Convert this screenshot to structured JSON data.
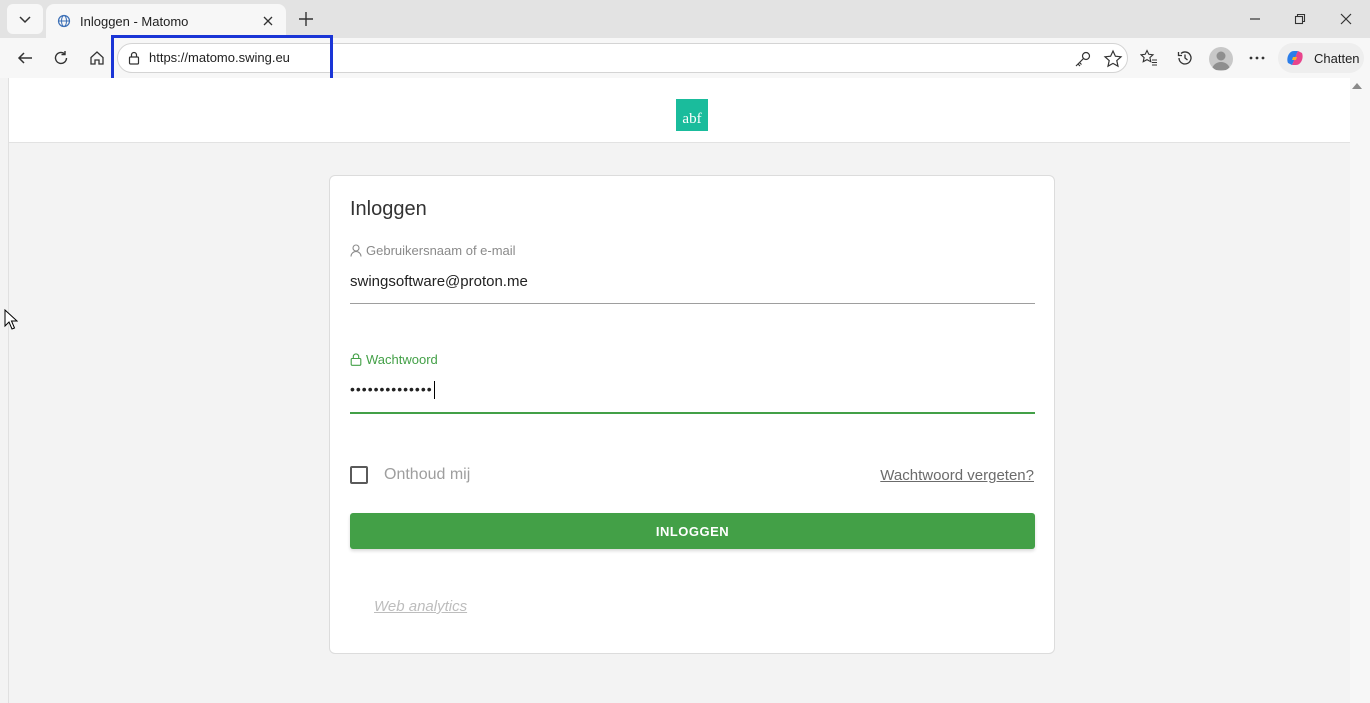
{
  "browser": {
    "tab": {
      "title": "Inloggen - Matomo"
    },
    "address": {
      "url": "https://matomo.swing.eu"
    },
    "copilot_label": "Chatten",
    "highlight_color": "#1a35d6"
  },
  "page": {
    "logo_text": "abf",
    "logo_color": "#1abc9c",
    "login": {
      "title": "Inloggen",
      "username_label": "Gebruikersnaam of e-mail",
      "username_value": "swingsoftware@proton.me",
      "password_label": "Wachtwoord",
      "password_value": "••••••••••••••",
      "remember_label": "Onthoud mij",
      "remember_checked": false,
      "forgot_link": "Wachtwoord vergeten?",
      "submit_label": "INLOGGEN",
      "accent_color": "#43a047"
    },
    "footer_link": "Web analytics"
  }
}
